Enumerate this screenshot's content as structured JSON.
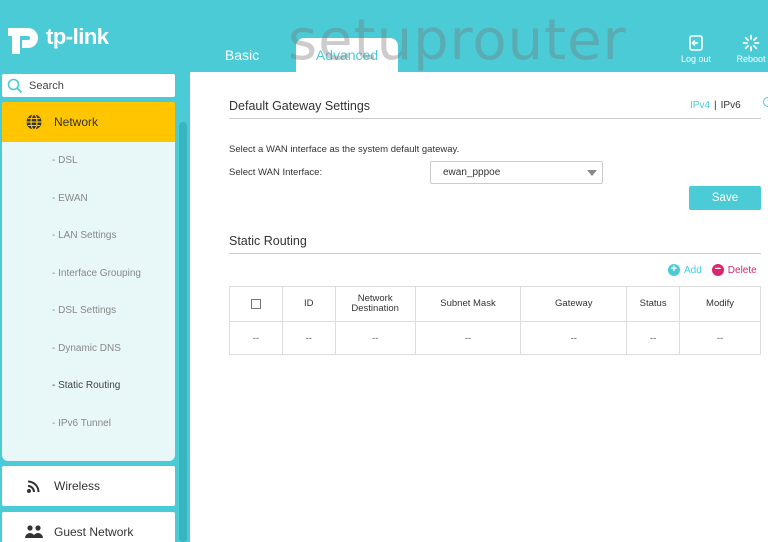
{
  "header": {
    "brand": "tp-link",
    "watermark": "setuprouter",
    "tabs": {
      "basic": "Basic",
      "advanced": "Advanced"
    },
    "logout_label": "Log out",
    "reboot_label": "Reboot"
  },
  "sidebar": {
    "search_placeholder": "Search",
    "network_label": "Network",
    "sub_items": [
      "- DSL",
      "- EWAN",
      "- LAN Settings",
      "- Interface Grouping",
      "- DSL Settings",
      "- Dynamic DNS",
      "- Static Routing",
      "- IPv6 Tunnel"
    ],
    "wireless_label": "Wireless",
    "guest_label": "Guest Network"
  },
  "gateway": {
    "title": "Default Gateway Settings",
    "ipv4": "IPv4",
    "separator": "|",
    "ipv6": "IPv6",
    "hint": "Select a WAN interface as the system default gateway.",
    "wan_label": "Select WAN Interface:",
    "wan_value": "ewan_pppoe",
    "save_label": "Save"
  },
  "routing": {
    "title": "Static Routing",
    "add_label": "Add",
    "delete_label": "Delete",
    "columns": [
      "ID",
      "Network Destination",
      "Subnet Mask",
      "Gateway",
      "Status",
      "Modify"
    ],
    "row": [
      "--",
      "--",
      "--",
      "--",
      "--",
      "--",
      "--"
    ]
  },
  "colors": {
    "accent": "#4acbd6",
    "highlight": "#ffc600",
    "delete": "#d9266e"
  }
}
